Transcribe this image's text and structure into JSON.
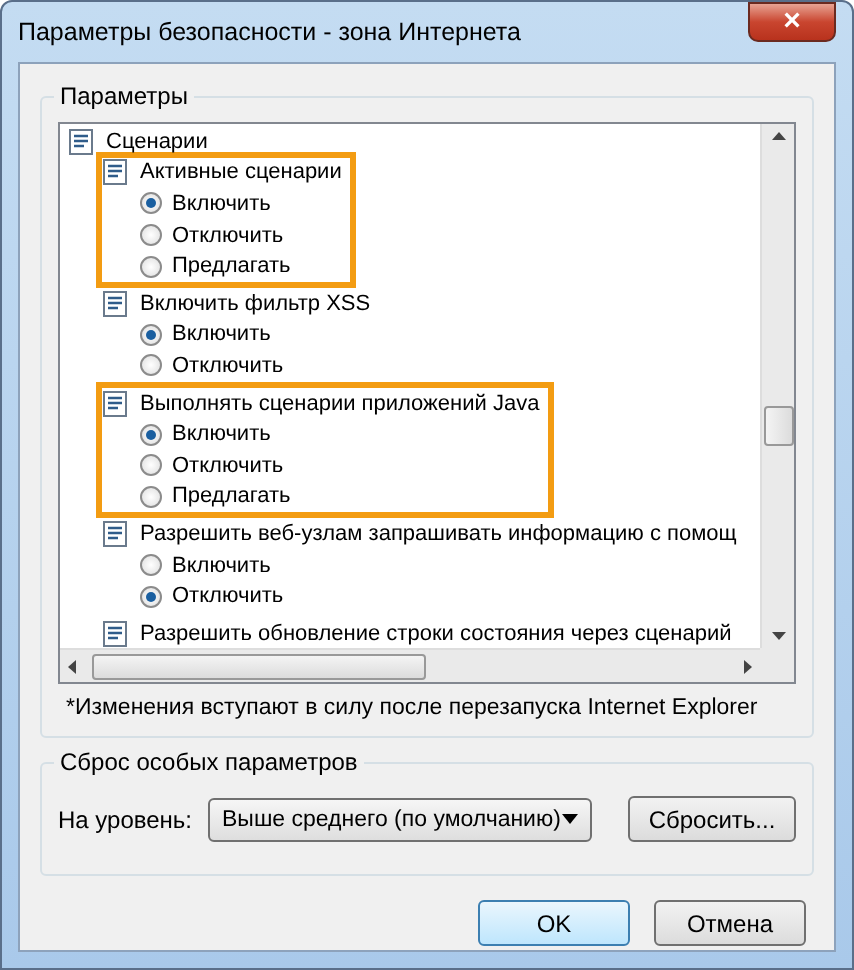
{
  "window": {
    "title": "Параметры безопасности - зона Интернета",
    "close": "×"
  },
  "settings": {
    "legend": "Параметры",
    "tree": [
      {
        "label": "Сценарии",
        "children": [
          {
            "label": "Активные сценарии",
            "highlighted": true,
            "options": [
              {
                "label": "Включить",
                "selected": true
              },
              {
                "label": "Отключить",
                "selected": false
              },
              {
                "label": "Предлагать",
                "selected": false
              }
            ]
          },
          {
            "label": "Включить фильтр XSS",
            "highlighted": false,
            "options": [
              {
                "label": "Включить",
                "selected": true
              },
              {
                "label": "Отключить",
                "selected": false
              }
            ]
          },
          {
            "label": "Выполнять сценарии приложений Java",
            "highlighted": true,
            "options": [
              {
                "label": "Включить",
                "selected": true
              },
              {
                "label": "Отключить",
                "selected": false
              },
              {
                "label": "Предлагать",
                "selected": false
              }
            ]
          },
          {
            "label": "Разрешить веб-узлам запрашивать информацию с помощ",
            "highlighted": false,
            "options": [
              {
                "label": "Включить",
                "selected": false
              },
              {
                "label": "Отключить",
                "selected": true
              }
            ]
          },
          {
            "label": "Разрешить обновление строки состояния через сценарий",
            "highlighted": false
          }
        ]
      }
    ],
    "note": "*Изменения вступают в силу после перезапуска Internet Explorer"
  },
  "reset": {
    "legend": "Сброс особых параметров",
    "level_label": "На уровень:",
    "level_value": "Выше среднего (по умолчанию)",
    "reset_button": "Сбросить..."
  },
  "buttons": [
    {
      "label": "OK",
      "default": true
    },
    {
      "label": "Отмена",
      "default": false
    }
  ]
}
